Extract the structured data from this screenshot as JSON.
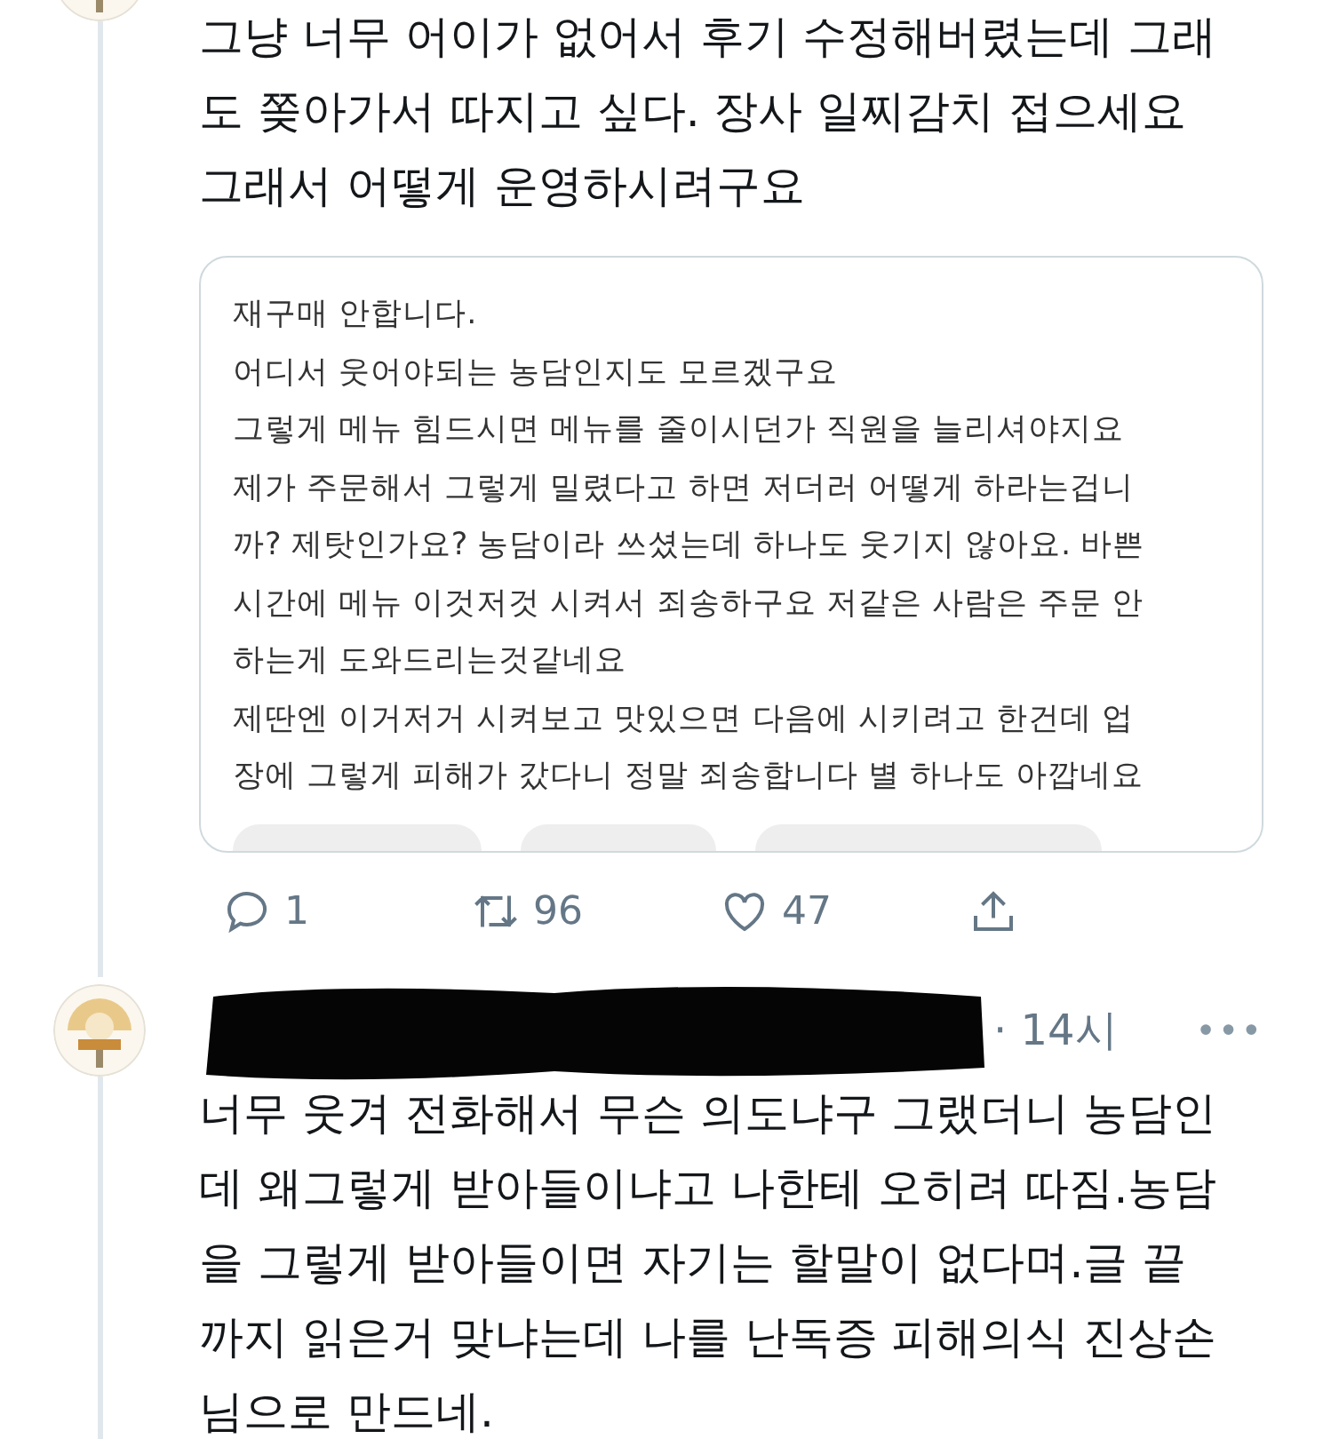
{
  "tweets": [
    {
      "kind": "reply",
      "lines": [
        "그냥 너무 어이가 없어서 후기 수정해버렸는데 그래",
        "도 쫒아가서 따지고 싶다. 장사 일찌감치 접으세요",
        "그래서 어떻게 운영하시려구요"
      ],
      "quote": {
        "lines": [
          "재구매 안합니다.",
          "어디서 웃어야되는 농담인지도 모르겠구요",
          "그렇게 메뉴 힘드시면 메뉴를 줄이시던가 직원을 늘리셔야지요",
          "제가 주문해서 그렇게 밀렸다고 하면 저더러 어떻게 하라는겁니",
          "까? 제탓인가요? 농담이라 쓰셨는데 하나도 웃기지 않아요. 바쁜",
          "시간에 메뉴 이것저것 시켜서 죄송하구요 저같은 사람은 주문 안",
          "하는게 도와드리는것같네요",
          "제딴엔 이거저거 시켜보고 맛있으면 다음에 시키려고 한건데 업",
          "장에 그렇게 피해가 갔다니 정말 죄송합니다 별 하나도 아깝네요"
        ]
      },
      "actions": {
        "replies": "1",
        "retweets": "96",
        "likes": "47"
      }
    },
    {
      "kind": "tweet",
      "header": {
        "time": "· 14시",
        "more": "•••"
      },
      "lines": [
        "너무 웃겨 전화해서 무슨 의도냐구 그랬더니 농담인",
        "데 왜그렇게 받아들이냐고 나한테 오히려 따짐.농담",
        "을 그렇게 받아들이면 자기는 할말이 없다며.글 끝",
        "까지 읽은거 맞냐는데 나를 난독증 피해의식 진상손",
        "님으로 만드네."
      ]
    }
  ]
}
